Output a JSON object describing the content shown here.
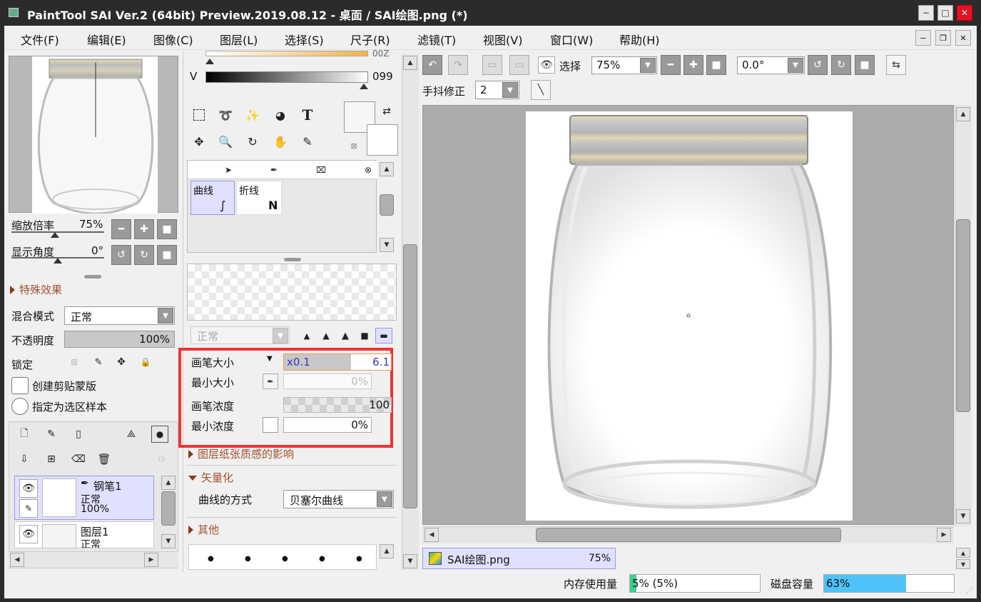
{
  "window": {
    "title": "PaintTool SAI Ver.2 (64bit) Preview.2019.08.12 - 桌面 / SAI绘图.png (*)",
    "minimize": "−",
    "maximize": "□",
    "close": "✕",
    "mdi_minimize": "−",
    "mdi_restore": "❐",
    "mdi_close": "✕"
  },
  "menu": [
    {
      "label": "文件(F)"
    },
    {
      "label": "编辑(E)"
    },
    {
      "label": "图像(C)"
    },
    {
      "label": "图层(L)"
    },
    {
      "label": "选择(S)"
    },
    {
      "label": "尺子(R)"
    },
    {
      "label": "滤镜(T)"
    },
    {
      "label": "视图(V)"
    },
    {
      "label": "窗口(W)"
    },
    {
      "label": "帮助(H)"
    }
  ],
  "navigator": {
    "zoom_label": "缩放倍率",
    "zoom_value": "75%",
    "angle_label": "显示角度",
    "angle_value": "0°"
  },
  "layer_props": {
    "effects_header": "特殊效果",
    "blend_label": "混合模式",
    "blend_value": "正常",
    "opacity_label": "不透明度",
    "opacity_value": "100%",
    "lock_label": "锁定",
    "clip_label": "创建剪贴蒙版",
    "sample_label": "指定为选区样本"
  },
  "layers": [
    {
      "name": "钢笔1",
      "mode": "正常",
      "opacity": "100%"
    },
    {
      "name": "图层1",
      "mode": "正常"
    }
  ],
  "color": {
    "v_label": "V",
    "v_value": "099",
    "top_value": "00Z"
  },
  "tools": {
    "text_icon": "T",
    "brushes": [
      {
        "label": "曲线"
      },
      {
        "label": "折线"
      }
    ]
  },
  "brush_settings": {
    "mode_value": "正常",
    "size_label": "画笔大小",
    "size_mult": "x0.1",
    "size_value": "6.1",
    "min_size_label": "最小大小",
    "min_size_value": "0%",
    "density_label": "画笔浓度",
    "density_value": "100",
    "min_density_label": "最小浓度",
    "min_density_value": "0%",
    "texture_header": "图层纸张质感的影响",
    "vector_header": "矢量化",
    "curve_label": "曲线的方式",
    "curve_value": "贝塞尔曲线",
    "other_header": "其他",
    "highlight_color": "#ee3333"
  },
  "canvas_toolbar": {
    "select_label": "选择",
    "zoom_value": "75%",
    "angle_value": "0.0°",
    "stabilizer_label": "手抖修正",
    "stabilizer_value": "2"
  },
  "document_tab": {
    "name": "SAI绘图.png",
    "zoom": "75%"
  },
  "status": {
    "memory_label": "内存使用量",
    "memory_value": "5% (5%)",
    "memory_fraction": 0.05,
    "disk_label": "磁盘容量",
    "disk_value": "63%",
    "disk_fraction": 0.63,
    "disk_color": "#4fc3f7",
    "memory_color": "#3ecf8e"
  }
}
